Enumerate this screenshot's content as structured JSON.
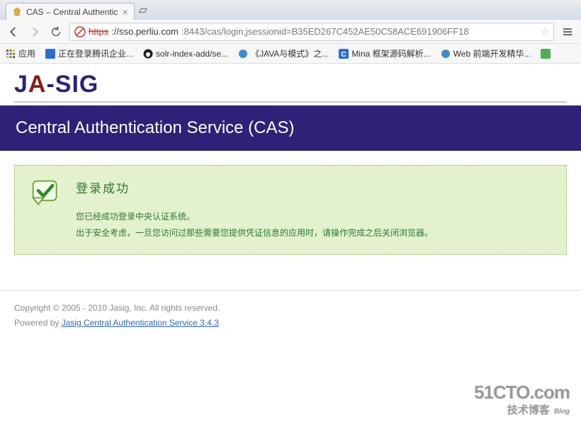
{
  "browser": {
    "tab_title": "CAS – Central Authentic",
    "url_scheme_strike": "https",
    "url_host": "://sso.perliu.com",
    "url_port_path": ":8443/cas/login;jsessionid=B35ED267C452AE50C58ACE691906FF18",
    "bookmarks": {
      "apps": "应用",
      "items": [
        "正在登录腾讯企业...",
        "solr-index-add/se...",
        "《JAVA与模式》之...",
        "Mina 框架源码解析...",
        "Web 前端开发精华..."
      ]
    }
  },
  "page": {
    "logo_text": "JA-SIG",
    "header": "Central Authentication Service (CAS)",
    "success": {
      "title": "登录成功",
      "line1": "您已经成功登录中央认证系统。",
      "line2": "出于安全考虑，一旦您访问过那些需要您提供凭证信息的应用时，请操作完成之后关闭浏览器。"
    },
    "footer": {
      "copyright": "Copyright © 2005 - 2010 Jasig, Inc. All rights reserved.",
      "powered_prefix": "Powered by ",
      "powered_link": "Jasig Central Authentication Service 3.4.3"
    }
  },
  "watermark": {
    "line1": "51CTO.com",
    "line2": "技术博客",
    "blog": "Blog"
  }
}
